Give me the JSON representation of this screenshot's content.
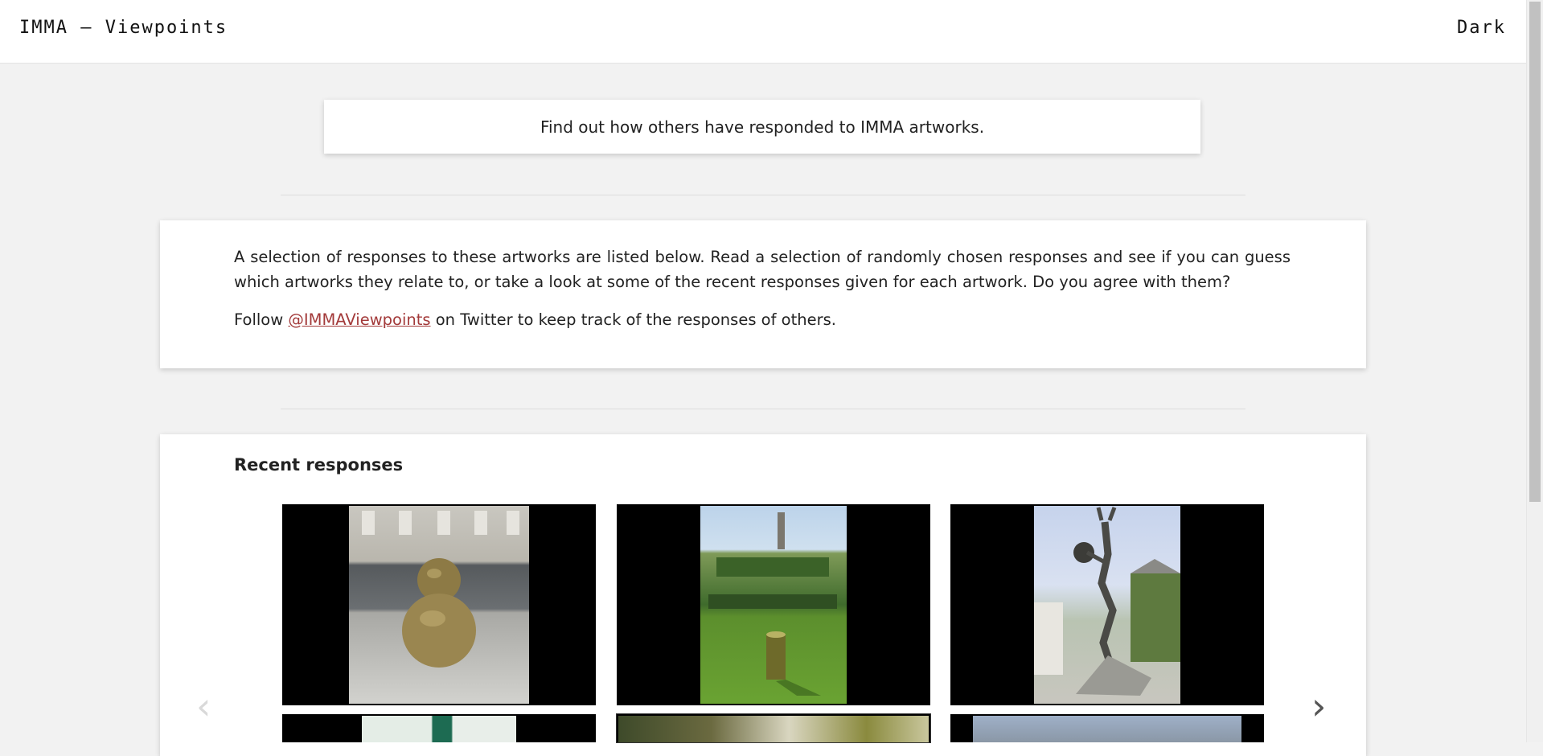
{
  "header": {
    "title": "IMMA – Viewpoints",
    "theme_toggle": "Dark"
  },
  "intro": {
    "text": "Find out how others have responded to IMMA artworks."
  },
  "info": {
    "paragraph": "A selection of responses to these artworks are listed below. Read a selection of randomly chosen responses and see if you can guess which artworks they relate to, or take a look at some of the recent responses given for each artwork. Do you agree with them?",
    "follow_prefix": "Follow",
    "follow_link": "@IMMAViewpoints",
    "follow_suffix": "on Twitter to keep track of the responses of others."
  },
  "recent": {
    "heading": "Recent responses",
    "prev_label": "‹",
    "next_label": "›"
  },
  "colors": {
    "link": "#a33a3a",
    "background": "#f2f2f2"
  }
}
